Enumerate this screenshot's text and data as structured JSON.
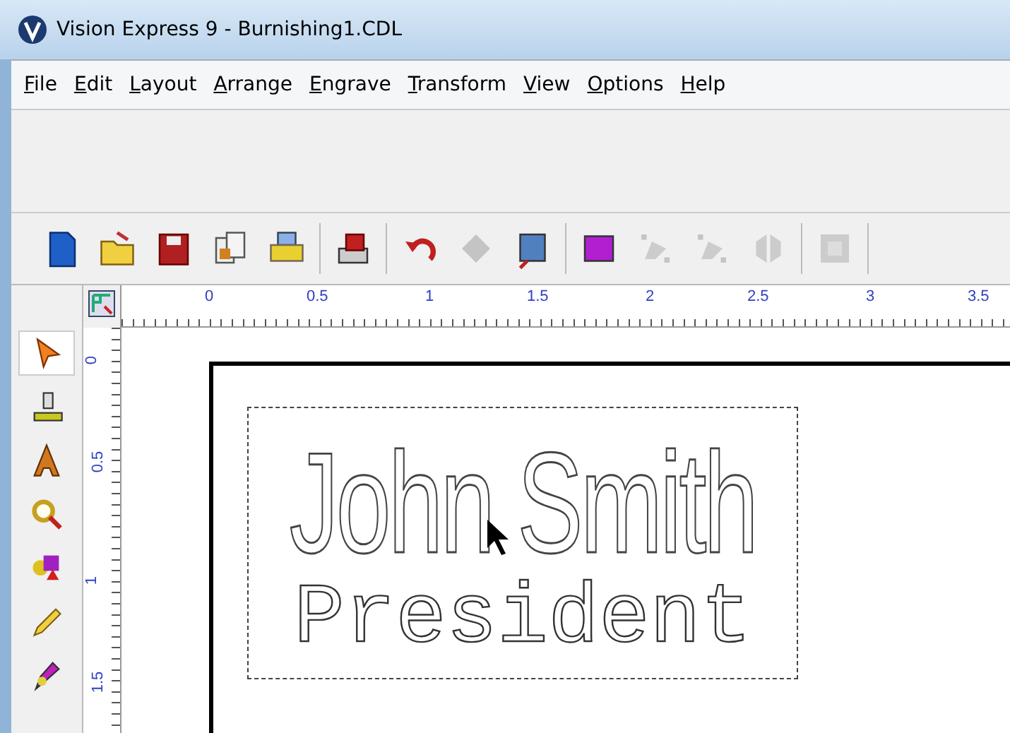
{
  "window": {
    "title": "Vision Express 9 - Burnishing1.CDL"
  },
  "menu": [
    {
      "label": "File"
    },
    {
      "label": "Edit"
    },
    {
      "label": "Layout"
    },
    {
      "label": "Arrange"
    },
    {
      "label": "Engrave"
    },
    {
      "label": "Transform"
    },
    {
      "label": "View"
    },
    {
      "label": "Options"
    },
    {
      "label": "Help"
    }
  ],
  "toolbar": {
    "groups": [
      [
        {
          "kind": "new",
          "disabled": false
        },
        {
          "kind": "open",
          "disabled": false
        },
        {
          "kind": "save",
          "disabled": false
        },
        {
          "kind": "files",
          "disabled": false
        },
        {
          "kind": "print",
          "disabled": false
        }
      ],
      [
        {
          "kind": "machine",
          "disabled": false
        }
      ],
      [
        {
          "kind": "undo",
          "disabled": false
        },
        {
          "kind": "diamond",
          "disabled": true
        },
        {
          "kind": "picture",
          "disabled": false
        }
      ],
      [
        {
          "kind": "frame",
          "disabled": false
        },
        {
          "kind": "node",
          "disabled": true
        },
        {
          "kind": "node",
          "disabled": true
        },
        {
          "kind": "mirror",
          "disabled": true
        }
      ],
      [
        {
          "kind": "puzzle",
          "disabled": true
        }
      ]
    ]
  },
  "ruler": {
    "horizontal": [
      "0",
      "0.5",
      "1",
      "1.5",
      "2",
      "2.5",
      "3",
      "3.5"
    ],
    "vertical": [
      "0",
      "0.5",
      "1",
      "1.5"
    ]
  },
  "tools": [
    {
      "kind": "pointer",
      "selected": true
    },
    {
      "kind": "engraver",
      "selected": false
    },
    {
      "kind": "text",
      "selected": false
    },
    {
      "kind": "zoom",
      "selected": false
    },
    {
      "kind": "shapes",
      "selected": false
    },
    {
      "kind": "pencil",
      "selected": false
    },
    {
      "kind": "pen",
      "selected": false
    }
  ],
  "canvas": {
    "lines": [
      {
        "kind": "script",
        "text": "John Smith"
      },
      {
        "kind": "block",
        "text": "President"
      }
    ]
  }
}
